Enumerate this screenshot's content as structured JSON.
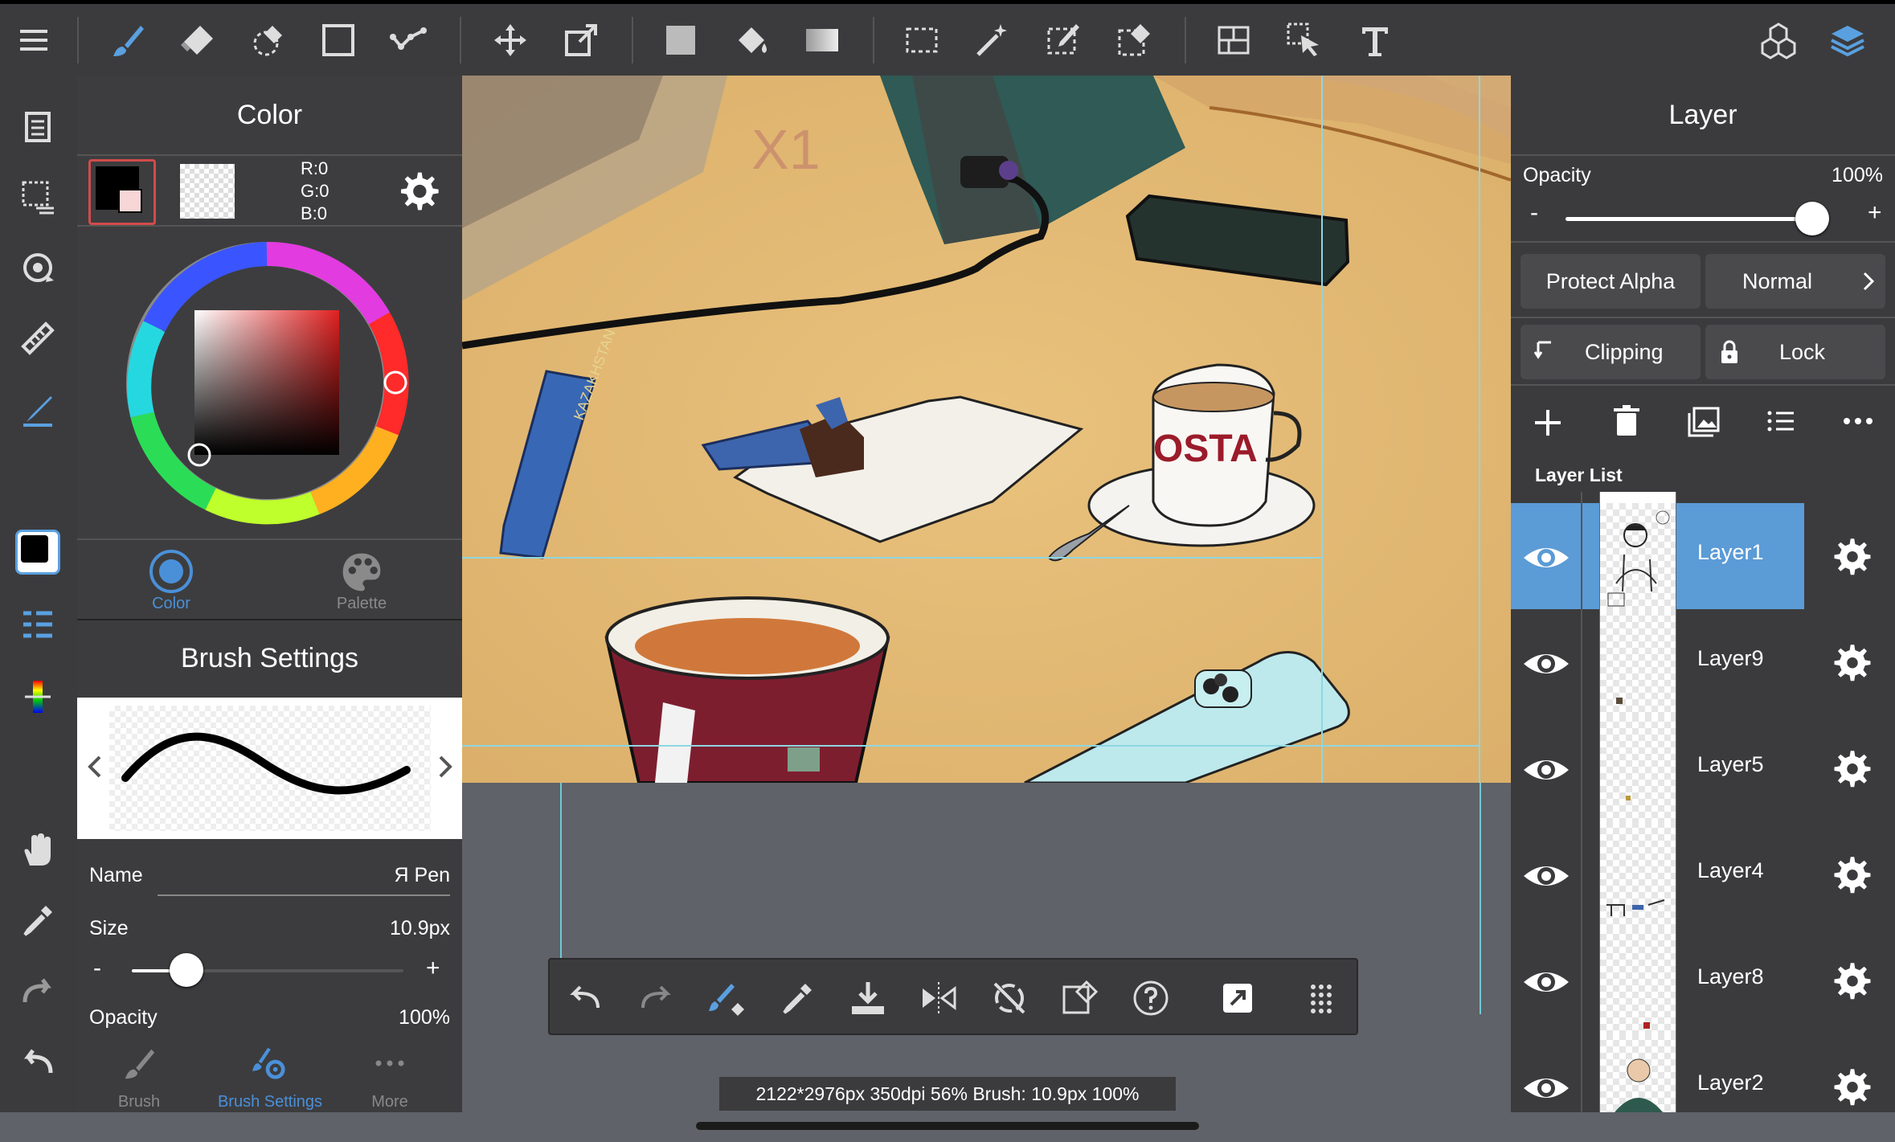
{
  "top_toolbar": {
    "icons": [
      "menu-icon",
      "brush-icon",
      "eraser-icon",
      "smudge-icon",
      "shape-icon",
      "lasso-icon",
      "move-icon",
      "transform-icon",
      "fill-color-icon",
      "bucket-icon",
      "gradient-icon",
      "select-rect-icon",
      "magic-wand-icon",
      "select-pen-icon",
      "select-eraser-icon",
      "frame-icon",
      "select-layer-icon",
      "text-icon",
      "3d-icon",
      "layers-icon"
    ]
  },
  "color_panel": {
    "title": "Color",
    "rgb": {
      "r": "R:0",
      "g": "G:0",
      "b": "B:0"
    },
    "tabs": {
      "color": "Color",
      "palette": "Palette"
    }
  },
  "brush_panel": {
    "title": "Brush Settings",
    "name_label": "Name",
    "name_value": "Я Pen",
    "size_label": "Size",
    "size_value": "10.9px",
    "size_fraction": 0.2,
    "opacity_label": "Opacity",
    "opacity_value": "100%",
    "minus": "-",
    "plus": "+",
    "tabs": {
      "brush": "Brush",
      "brush_settings": "Brush Settings",
      "more": "More"
    }
  },
  "layer_panel": {
    "title": "Layer",
    "opacity_label": "Opacity",
    "opacity_value": "100%",
    "opacity_fraction": 1.0,
    "minus": "-",
    "plus": "+",
    "protect_alpha": "Protect Alpha",
    "blend_mode": "Normal",
    "clipping": "Clipping",
    "lock": "Lock",
    "list_label": "Layer List",
    "layers": [
      {
        "name": "Layer1",
        "selected": true
      },
      {
        "name": "Layer9",
        "selected": false
      },
      {
        "name": "Layer5",
        "selected": false
      },
      {
        "name": "Layer4",
        "selected": false
      },
      {
        "name": "Layer8",
        "selected": false
      },
      {
        "name": "Layer2",
        "selected": false
      }
    ]
  },
  "canvas_art": {
    "x1_label": "X1",
    "cup_text": "OSTA",
    "wrapper_text": "KAZAKHSTAN"
  },
  "status": "2122*2976px 350dpi 56% Brush: 10.9px 100%",
  "colors": {
    "accent": "#4a90d9",
    "selected_layer": "#5b9bd6",
    "panel": "#3b3b3d",
    "canvas": "#e2b977"
  }
}
